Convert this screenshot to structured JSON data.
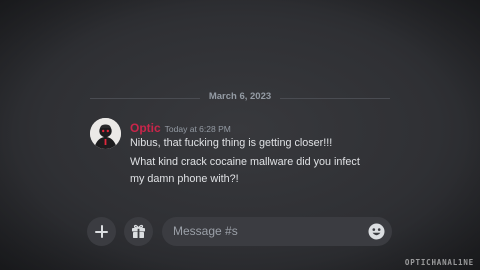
{
  "date_divider": {
    "text": "March 6, 2023"
  },
  "message": {
    "username": "Optic",
    "username_color": "#c9254a",
    "timestamp": "Today at 6:28 PM",
    "lines": [
      "Nibus, that fucking thing is getting closer!!!",
      "What kind crack cocaine mallware did you infect",
      "my damn phone with?!"
    ],
    "avatar_icon": "masked-figure-avatar"
  },
  "composer": {
    "plus_icon": "plus-icon",
    "gift_icon": "gift-icon",
    "placeholder": "Message #s",
    "emoji_icon": "emoji-smile-icon"
  },
  "watermark": {
    "text": "OPTICHANAL1NE"
  },
  "colors": {
    "background": "#313338",
    "input_background": "#3b3c41",
    "muted_text": "#949ba4"
  }
}
